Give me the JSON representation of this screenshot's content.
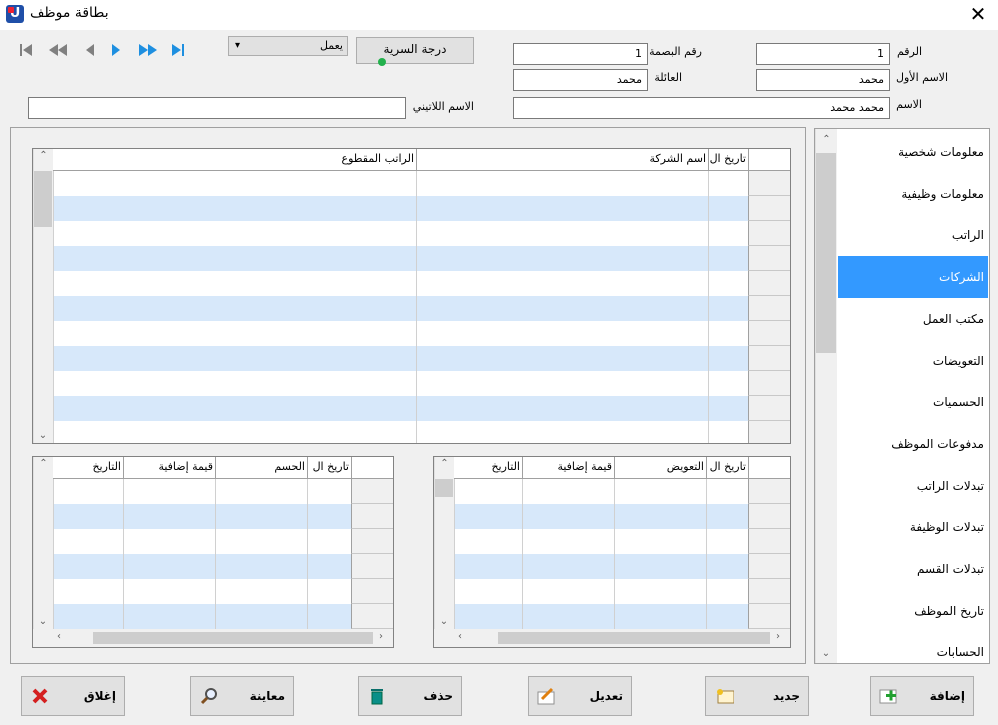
{
  "window": {
    "title": "بطاقة موظف",
    "close": "✕"
  },
  "nav": {
    "first": "first",
    "prev_page": "prev-page",
    "prev": "prev",
    "next": "next",
    "next_page": "next-page",
    "last": "last"
  },
  "status_combo": {
    "value": "يعمل",
    "arrow": "▾"
  },
  "secrecy_button": {
    "label": "درجة السرية"
  },
  "form": {
    "number_label": "الرقم",
    "number": "1",
    "fingerprint_label": "رقم البصمة",
    "fingerprint": "1",
    "first_name_label": "الاسم الأول",
    "first_name": "محمد",
    "family_label": "العائلة",
    "family": "محمد",
    "name_label": "الاسم",
    "name": "محمد محمد",
    "latin_name_label": "الاسم اللاتيني",
    "latin_name": ""
  },
  "main_grid": {
    "columns": [
      "تاريخ ال",
      "اسم الشركة",
      "الراتب المقطوع"
    ]
  },
  "left_grid": {
    "columns": [
      "تاريخ ال",
      "الحسم",
      "قيمة إضافية",
      "التاريخ"
    ]
  },
  "right_grid": {
    "columns": [
      "تاريخ ال",
      "التعويض",
      "قيمة إضافية",
      "التاريخ"
    ]
  },
  "sidebar": {
    "items": [
      {
        "label": "معلومات شخصية"
      },
      {
        "label": "معلومات وظيفية"
      },
      {
        "label": "الراتب"
      },
      {
        "label": "الشركات"
      },
      {
        "label": "مكتب العمل"
      },
      {
        "label": "التعويضات"
      },
      {
        "label": "الحسميات"
      },
      {
        "label": "مدفوعات الموظف"
      },
      {
        "label": "تبدلات الراتب"
      },
      {
        "label": "تبدلات الوظيفة"
      },
      {
        "label": "تبدلات القسم"
      },
      {
        "label": "تاريخ الموظف"
      },
      {
        "label": "الحسابات"
      }
    ],
    "selected": "الشركات"
  },
  "buttons": {
    "close": "إغلاق",
    "preview": "معاينة",
    "delete": "حذف",
    "edit": "تعديل",
    "new": "جديد",
    "add": "إضافة"
  },
  "colors": {
    "selection": "#3399ff",
    "alt_row": "#d7e8fa",
    "accent": "#1f4fa8"
  }
}
